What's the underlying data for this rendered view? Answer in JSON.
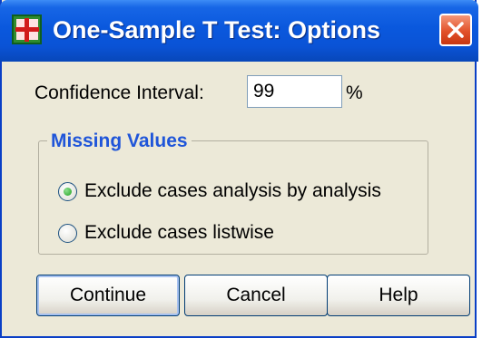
{
  "window": {
    "title": "One-Sample T Test: Options",
    "close_label": "Close"
  },
  "confidence": {
    "label": "Confidence Interval:",
    "value": "99",
    "unit": "%"
  },
  "missing_values": {
    "title": "Missing Values",
    "options": [
      {
        "label": "Exclude cases analysis by analysis",
        "selected": true
      },
      {
        "label": "Exclude cases listwise",
        "selected": false
      }
    ]
  },
  "buttons": {
    "continue": "Continue",
    "cancel": "Cancel",
    "help": "Help"
  },
  "colors": {
    "titlebar": "#0a58dd",
    "dialog_bg": "#ece9d8",
    "group_title": "#1f55d9",
    "close_button": "#e2522a"
  }
}
